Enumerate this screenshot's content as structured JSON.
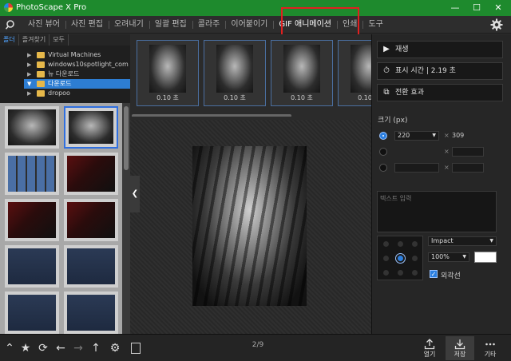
{
  "app": {
    "title": "PhotoScape X Pro"
  },
  "window_controls": {
    "minimize": "—",
    "maximize": "☐",
    "close": "✕"
  },
  "menu": {
    "tabs": [
      "사진 뷰어",
      "사진 편집",
      "오려내기",
      "일괄 편집",
      "콜라주",
      "이어붙이기",
      "GIF 애니메이션",
      "인쇄",
      "도구"
    ],
    "active_tab": "GIF 애니메이션",
    "highlight_color": "#e02020"
  },
  "left_panel": {
    "tabs": [
      "폴더",
      "즐겨찾기",
      "모두"
    ],
    "tree": [
      {
        "label": "Virtual Machines",
        "selected": false
      },
      {
        "label": "windows10spotlight_com",
        "selected": false
      },
      {
        "label": "뉴 다운로드",
        "selected": false
      },
      {
        "label": "다운로드",
        "selected": true
      },
      {
        "label": "dropoo",
        "selected": false
      }
    ],
    "thumbnails": [
      {
        "kind": "tiger",
        "selected": false
      },
      {
        "kind": "tiger",
        "selected": true
      },
      {
        "kind": "grid",
        "selected": false
      },
      {
        "kind": "phone",
        "selected": false
      },
      {
        "kind": "phone",
        "selected": false
      },
      {
        "kind": "phone",
        "selected": false
      },
      {
        "kind": "doc",
        "selected": false
      },
      {
        "kind": "doc",
        "selected": false
      },
      {
        "kind": "doc",
        "selected": false
      },
      {
        "kind": "doc",
        "selected": false
      }
    ]
  },
  "frames": [
    {
      "duration": "0.10 초"
    },
    {
      "duration": "0.10 초"
    },
    {
      "duration": "0.10 초"
    },
    {
      "duration": "0.10 초"
    }
  ],
  "canvas": {
    "pager": "2/9"
  },
  "right_panel": {
    "play": "재생",
    "display_time": "표시 시간 | 2.19 초",
    "transition": "전환 효과",
    "size_label": "크기 (px)",
    "width": "220",
    "height": "309",
    "separator": "×",
    "text_placeholder": "텍스트 입력",
    "font": "Impact",
    "zoom": "100%",
    "outline_label": "외곽선",
    "outline_checked": true
  },
  "bottom": {
    "open": "열기",
    "save": "저장",
    "more": "기타"
  },
  "colors": {
    "titlebar": "#1e8a2d",
    "accent": "#2b7fe0"
  }
}
